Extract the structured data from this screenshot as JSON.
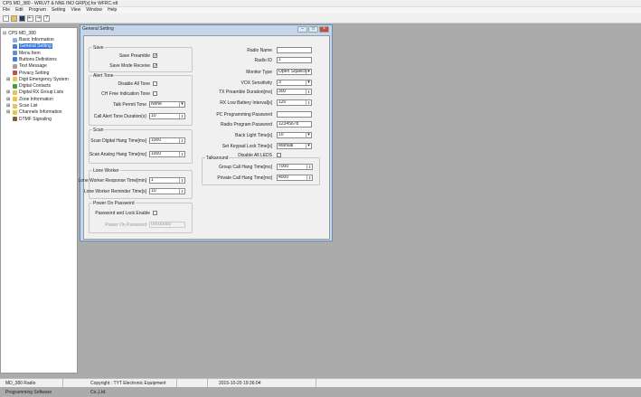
{
  "window": {
    "title": "CPS MD_380 - WRLVT & NNE INO GRP[x] for WFRC.rdt"
  },
  "menu": [
    "File",
    "Edit",
    "Program",
    "Setting",
    "View",
    "Window",
    "Help"
  ],
  "toolbar": [
    "new",
    "open",
    "save",
    "read",
    "write",
    "about"
  ],
  "tree": {
    "root": "CPS MD_380",
    "items": [
      {
        "label": "Basic Information",
        "icon": "info-icon",
        "color": "#8fb0d8"
      },
      {
        "label": "General Setting",
        "icon": "gear-icon",
        "color": "#4a7fd0",
        "selected": true
      },
      {
        "label": "Menu Item",
        "icon": "menu-icon",
        "color": "#6a8fc8"
      },
      {
        "label": "Buttons Definitions",
        "icon": "button-icon",
        "color": "#3a7ee0"
      },
      {
        "label": "Text Message",
        "icon": "message-icon",
        "color": "#a0a0a0"
      },
      {
        "label": "Privacy Setting",
        "icon": "key-icon",
        "color": "#c05050"
      },
      {
        "label": "Digit Emergency System",
        "icon": "folder-icon",
        "color": "#e8c450",
        "expandable": true
      },
      {
        "label": "Digital Contacts",
        "icon": "contacts-icon",
        "color": "#40a040"
      },
      {
        "label": "Digital RX Group Lists",
        "icon": "folder-icon",
        "color": "#e8c450",
        "expandable": true
      },
      {
        "label": "Zone Information",
        "icon": "folder-icon",
        "color": "#e8c450",
        "expandable": true
      },
      {
        "label": "Scan List",
        "icon": "folder-icon",
        "color": "#e8c450",
        "expandable": true
      },
      {
        "label": "Channels Information",
        "icon": "folder-icon",
        "color": "#e8c450",
        "expandable": true
      },
      {
        "label": "DTMF Signaling",
        "icon": "dtmf-icon",
        "color": "#806040"
      }
    ]
  },
  "dialog": {
    "title": "General Setting",
    "save": {
      "title": "Save",
      "preamble": "Save Preamble",
      "preamble_checked": "✓",
      "mode_receive": "Save Mode Receive",
      "mode_receive_checked": "✓"
    },
    "alert": {
      "title": "Alert Tone",
      "disable_all": "Disable All Tone",
      "ch_free": "CH Free Indication Tone",
      "talk_permit": "Talk Permit Tone",
      "talk_permit_value": "None",
      "call_alert": "Call Alert Tone Duration(s)",
      "call_alert_value": "10"
    },
    "scan": {
      "title": "Scan",
      "digital": "Scan Digital Hang Time[ms]",
      "digital_value": "1000",
      "analog": "Scan Analog Hang Time[ms]",
      "analog_value": "1000"
    },
    "lone": {
      "title": "Lone Worker",
      "response": "Lone Worker Response Time[min]",
      "response_value": "1",
      "reminder": "Lone Worker Reminder Time[s]",
      "reminder_value": "10"
    },
    "power": {
      "title": "Power On Password",
      "lock": "Password and Lock Enable",
      "pwd": "Power On Password",
      "pwd_value": "00000000"
    },
    "right": {
      "radio_name": "Radio Name",
      "radio_name_value": "",
      "radio_id": "Radio ID",
      "radio_id_value": "1",
      "monitor": "Monitor Type",
      "monitor_value": "Open Squelch",
      "vox": "VOX Sensitivity",
      "vox_value": "3",
      "tx_pre": "TX Preamble Duration[ms]",
      "tx_pre_value": "300",
      "rx_low": "RX Low Battery Interval[s]",
      "rx_low_value": "120",
      "pc_pwd": "PC Programming Password",
      "pc_pwd_value": "",
      "radio_pwd": "Radio Program Password",
      "radio_pwd_value": "12345678",
      "backlight": "Back Light Time[s]",
      "backlight_value": "10",
      "keypad": "Set Keypad Lock Time[s]",
      "keypad_value": "Manual",
      "leds": "Disable All LEDS"
    },
    "talkaround": {
      "title": "Talkaround",
      "group": "Group Call Hang Time[ms]",
      "group_value": "7000",
      "private": "Private Call Hang Time[ms]",
      "private_value": "4000"
    }
  },
  "status": {
    "app": "MD_380 Radio Programming Software",
    "copyright": "Copyright : TYT Electronic Equipment Co.,Ltd.",
    "empty": "",
    "datetime": "2015-10-20 19:36:04"
  }
}
